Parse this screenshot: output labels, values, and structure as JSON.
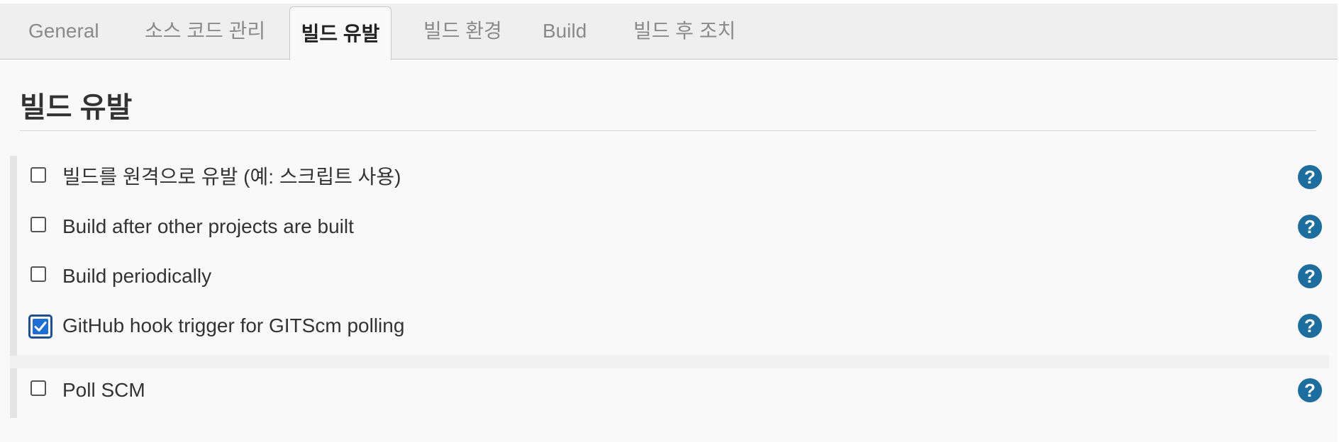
{
  "tabs": [
    {
      "label": "General",
      "active": false
    },
    {
      "label": "소스 코드 관리",
      "active": false
    },
    {
      "label": "빌드 유발",
      "active": true
    },
    {
      "label": "빌드 환경",
      "active": false
    },
    {
      "label": "Build",
      "active": false
    },
    {
      "label": "빌드 후 조치",
      "active": false
    }
  ],
  "section": {
    "title": "빌드 유발"
  },
  "options": [
    {
      "label": "빌드를 원격으로 유발 (예: 스크립트 사용)",
      "checked": false,
      "help_icon": "question-circle-icon"
    },
    {
      "label": "Build after other projects are built",
      "checked": false,
      "help_icon": "question-circle-icon"
    },
    {
      "label": "Build periodically",
      "checked": false,
      "help_icon": "question-circle-icon"
    },
    {
      "label": "GitHub hook trigger for GITScm polling",
      "checked": true,
      "help_icon": "question-circle-icon"
    },
    {
      "label": "Poll SCM",
      "checked": false,
      "help_icon": "question-circle-icon"
    }
  ],
  "help": {
    "glyph": "?"
  },
  "colors": {
    "help_icon": "#1c6ea0",
    "checkbox_checked": "#1c6fd6",
    "active_tab_text": "#222222",
    "inactive_tab_text": "#8a8a8a"
  }
}
